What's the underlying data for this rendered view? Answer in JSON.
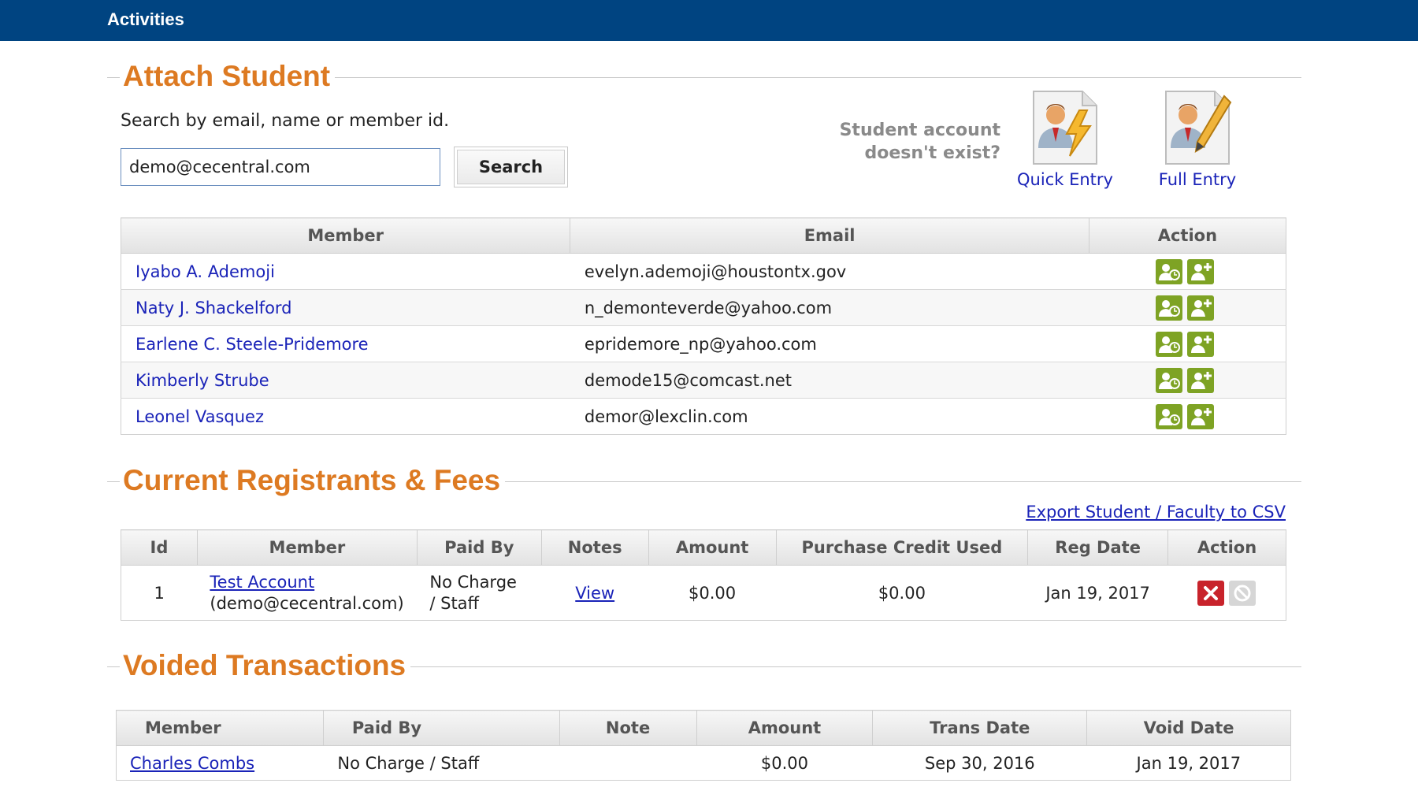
{
  "header": {
    "title": "Activities"
  },
  "attach": {
    "title": "Attach Student",
    "search_label": "Search by email, name or member id.",
    "search_value": "demo@cecentral.com",
    "search_button": "Search",
    "no_account_line1": "Student account",
    "no_account_line2": "doesn't exist?",
    "quick_entry": "Quick Entry",
    "full_entry": "Full Entry"
  },
  "members_table": {
    "headers": {
      "member": "Member",
      "email": "Email",
      "action": "Action"
    },
    "rows": [
      {
        "name": "Iyabo A. Ademoji",
        "email": "evelyn.ademoji@houstontx.gov"
      },
      {
        "name": "Naty J. Shackelford",
        "email": "n_demonteverde@yahoo.com"
      },
      {
        "name": "Earlene C. Steele-Pridemore",
        "email": "epridemore_np@yahoo.com"
      },
      {
        "name": "Kimberly Strube",
        "email": "demode15@comcast.net"
      },
      {
        "name": "Leonel Vasquez",
        "email": "demor@lexclin.com"
      }
    ]
  },
  "registrants": {
    "title": "Current Registrants & Fees",
    "export_link": "Export Student / Faculty to CSV",
    "headers": {
      "id": "Id",
      "member": "Member",
      "paid_by": "Paid By",
      "notes": "Notes",
      "amount": "Amount",
      "credit": "Purchase Credit Used",
      "reg_date": "Reg Date",
      "action": "Action"
    },
    "rows": [
      {
        "id": "1",
        "name": "Test Account",
        "email": "(demo@cecentral.com)",
        "paid_by_1": "No Charge",
        "paid_by_2": "/ Staff",
        "notes": "View",
        "amount": "$0.00",
        "credit": "$0.00",
        "reg_date": "Jan 19, 2017"
      }
    ]
  },
  "voided": {
    "title": "Voided Transactions",
    "headers": {
      "member": "Member",
      "paid_by": "Paid By",
      "note": "Note",
      "amount": "Amount",
      "trans_date": "Trans Date",
      "void_date": "Void Date"
    },
    "rows": [
      {
        "member": "Charles Combs",
        "paid_by": "No Charge / Staff",
        "note": "",
        "amount": "$0.00",
        "trans_date": "Sep 30, 2016",
        "void_date": "Jan 19, 2017"
      }
    ]
  },
  "colors": {
    "header_bg": "#004481",
    "section_title": "#dd7a22",
    "link": "#1a23b8",
    "action_green": "#7ea324",
    "delete_red": "#c8232b"
  },
  "icons": [
    "person-clock-icon",
    "person-add-icon",
    "quick-entry-icon",
    "full-entry-icon",
    "delete-icon",
    "void-icon"
  ]
}
